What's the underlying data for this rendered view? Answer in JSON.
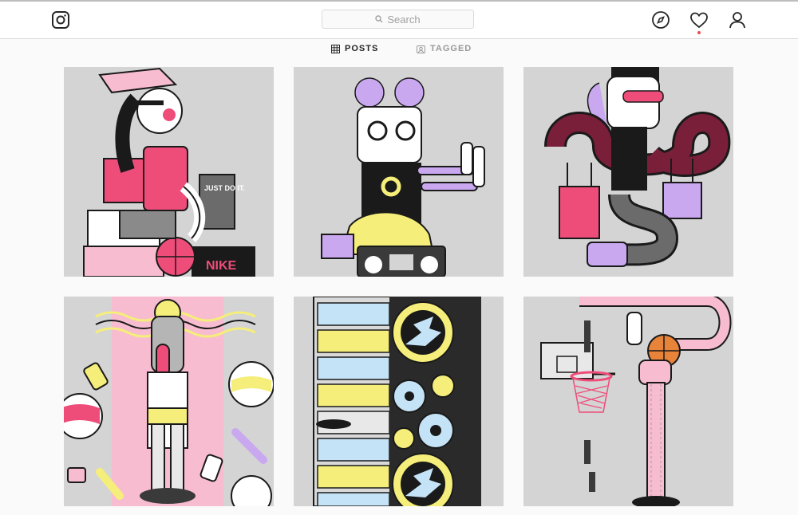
{
  "nav": {
    "search_placeholder": "Search",
    "icons": [
      "instagram-logo-icon",
      "search-icon",
      "compass-icon",
      "heart-icon",
      "user-icon"
    ],
    "notification_dot_color": "#ed4956"
  },
  "tabs": [
    {
      "label": "POSTS",
      "icon": "grid-icon",
      "active": true
    },
    {
      "label": "TAGGED",
      "icon": "tagged-icon",
      "active": false
    }
  ],
  "grid": {
    "rows": 2,
    "columns": 3,
    "posts": [
      {
        "subject": "character sitting on shoe boxes",
        "visible_text": [
          "JUST DO IT.",
          "NIKE"
        ]
      },
      {
        "subject": "character kneeling on boombox",
        "visible_text": []
      },
      {
        "subject": "character with shopping bags",
        "visible_text": []
      },
      {
        "subject": "character with candy and balls",
        "visible_text": []
      },
      {
        "subject": "stereo rack and speaker",
        "visible_text": []
      },
      {
        "subject": "basketball hoop and figure",
        "visible_text": []
      }
    ]
  },
  "colors": {
    "tile_background": "#d4d4d4",
    "pink": "#ee4d7a",
    "yellow": "#f5ee7a",
    "lavender": "#c9a8f0"
  }
}
